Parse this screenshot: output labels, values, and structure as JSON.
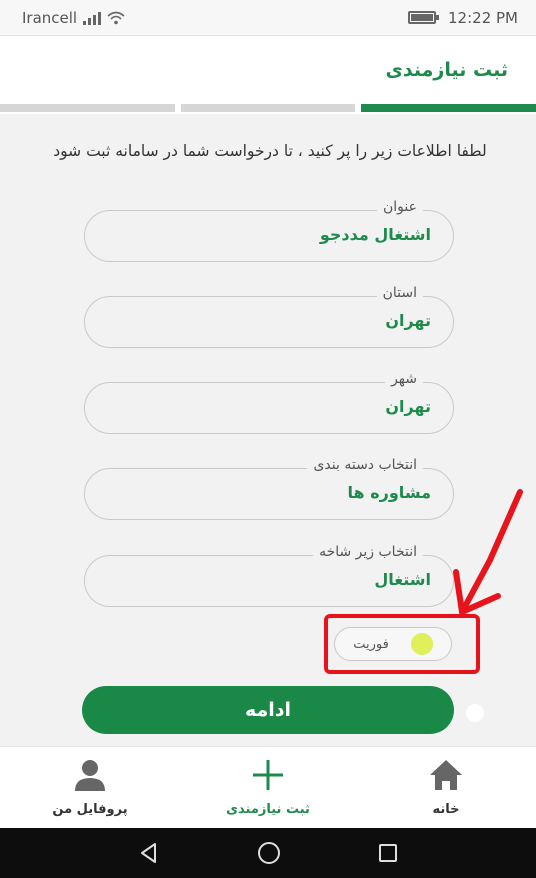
{
  "status_bar": {
    "carrier": "Irancell",
    "time": "12:22 PM",
    "signal_icon": "signal-bars-icon",
    "wifi_icon": "wifi-icon",
    "battery_icon": "battery-icon"
  },
  "header": {
    "title": "ثبت نیازمندی"
  },
  "progress": {
    "steps_total": 3,
    "active_step": 3
  },
  "intro_text": "لطفا اطلاعات زیر را پر کنید ، تا درخواست شما در سامانه ثبت شود",
  "fields": [
    {
      "label": "عنوان",
      "value": "اشتغال مددجو"
    },
    {
      "label": "استان",
      "value": "تهران"
    },
    {
      "label": "شهر",
      "value": "تهران"
    },
    {
      "label": "انتخاب دسته بندی",
      "value": "مشاوره ها"
    },
    {
      "label": "انتخاب زیر شاخه",
      "value": "اشتغال"
    }
  ],
  "urgent_toggle": {
    "label": "فوریت",
    "state": "off"
  },
  "continue_button": {
    "label": "ادامه"
  },
  "bottom_nav": {
    "profile": {
      "label": "پروفایل من",
      "icon": "person-icon"
    },
    "register": {
      "label": "ثبت نیازمندی",
      "icon": "plus-icon"
    },
    "home": {
      "label": "خانه",
      "icon": "home-icon"
    }
  },
  "system_nav": {
    "back_icon": "back-triangle-icon",
    "home_icon": "home-circle-icon",
    "recents_icon": "recents-square-icon"
  },
  "colors": {
    "brand_green": "#1e8a4c",
    "annotation_red": "#e8141c",
    "toggle_knob": "#dff05a"
  }
}
